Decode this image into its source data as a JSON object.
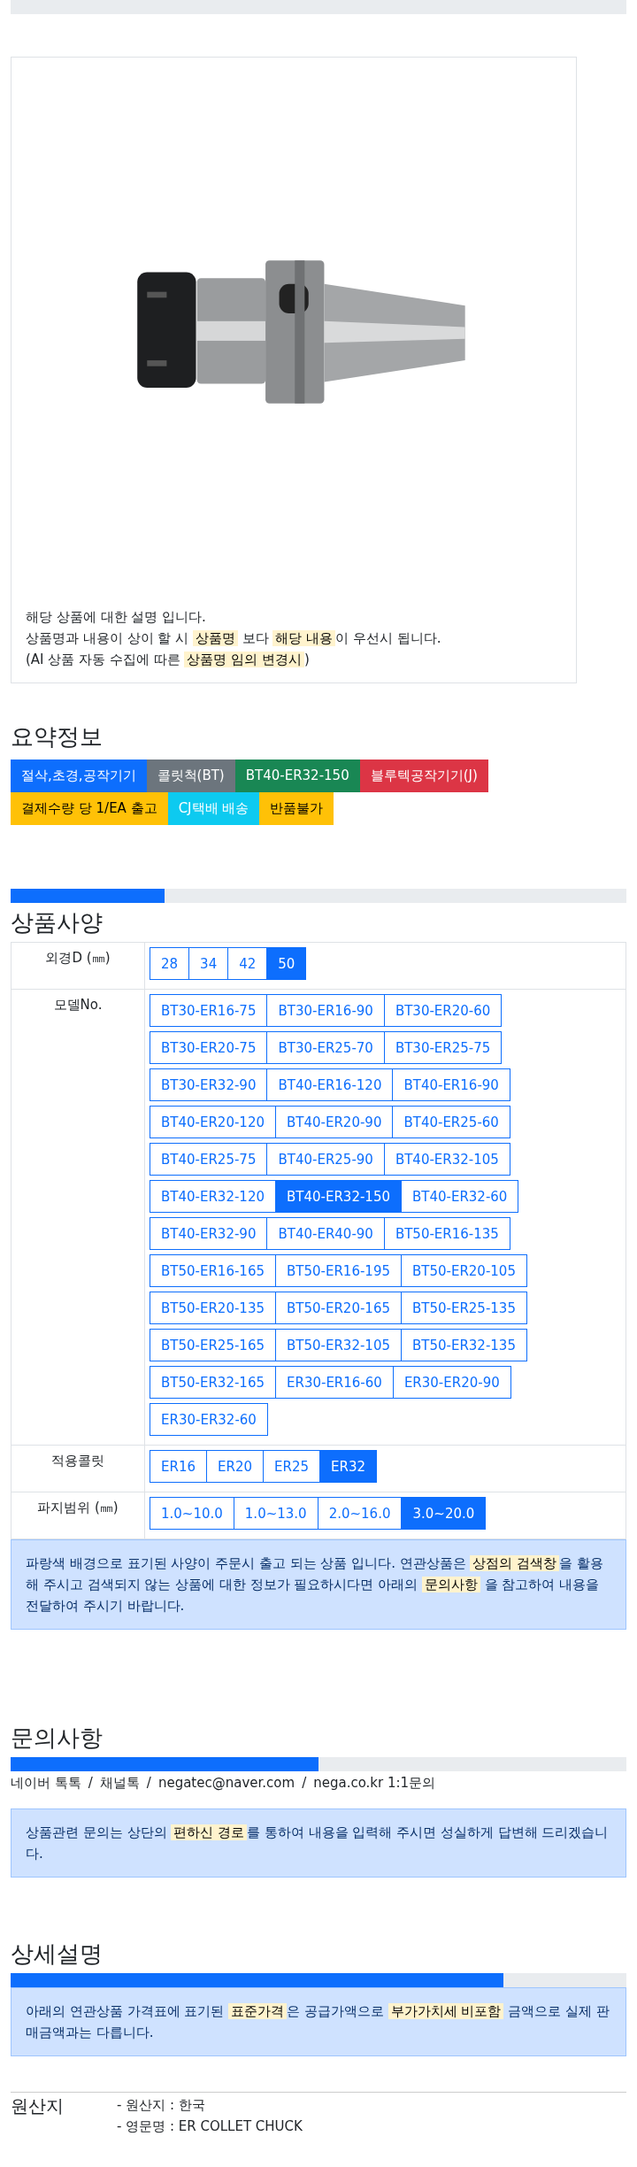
{
  "product_card": {
    "image": {
      "kind": "picture"
    },
    "notes": [
      [
        {
          "text": "해당 상품에 대한 설명 입니다.",
          "highlight": false
        }
      ],
      [
        {
          "text": "상품명과 내용이 상이 할 시 ",
          "highlight": false
        },
        {
          "text": "상품명",
          "highlight": true
        },
        {
          "text": " 보다 ",
          "highlight": false
        },
        {
          "text": "해당 내용",
          "highlight": true
        },
        {
          "text": "이 우선시 됩니다.",
          "highlight": false
        }
      ],
      [
        {
          "text": "(AI 상품 자동 수집에 따른 ",
          "highlight": false
        },
        {
          "text": "상품명 임의 변경시",
          "highlight": true
        },
        {
          "text": ")",
          "highlight": false
        }
      ]
    ]
  },
  "summary": {
    "title": "요약정보",
    "tags": [
      {
        "label": "절삭,초경,공작기기",
        "color": "#0d6efd"
      },
      {
        "label": "콜릿척(BT)",
        "color": "#6c757d"
      },
      {
        "label": "BT40-ER32-150",
        "color": "#198754"
      },
      {
        "label": "블루텍공작기기(J)",
        "color": "#dc3545"
      },
      {
        "label": "결제수량 당 1/EA 출고",
        "color": "#ffc107"
      },
      {
        "label": "CJ택배 배송",
        "color": "#0dcaf0"
      },
      {
        "label": "반품불가",
        "color": "#ffc107"
      }
    ]
  },
  "spec": {
    "progress": {
      "level": 0.25
    },
    "title": "상품사양",
    "rows": [
      {
        "label": "외경D (㎜)",
        "options": [
          {
            "label": "28",
            "selected": false
          },
          {
            "label": "34",
            "selected": false
          },
          {
            "label": "42",
            "selected": false
          },
          {
            "label": "50",
            "selected": true
          }
        ]
      },
      {
        "label": "모델No.",
        "options": [
          {
            "label": "BT30-ER16-75",
            "selected": false
          },
          {
            "label": "BT30-ER16-90",
            "selected": false
          },
          {
            "label": "BT30-ER20-60",
            "selected": false
          },
          {
            "label": "BT30-ER20-75",
            "selected": false
          },
          {
            "label": "BT30-ER25-70",
            "selected": false
          },
          {
            "label": "BT30-ER25-75",
            "selected": false
          },
          {
            "label": "BT30-ER32-90",
            "selected": false
          },
          {
            "label": "BT40-ER16-120",
            "selected": false
          },
          {
            "label": "BT40-ER16-90",
            "selected": false
          },
          {
            "label": "BT40-ER20-120",
            "selected": false
          },
          {
            "label": "BT40-ER20-90",
            "selected": false
          },
          {
            "label": "BT40-ER25-60",
            "selected": false
          },
          {
            "label": "BT40-ER25-75",
            "selected": false
          },
          {
            "label": "BT40-ER25-90",
            "selected": false
          },
          {
            "label": "BT40-ER32-105",
            "selected": false
          },
          {
            "label": "BT40-ER32-120",
            "selected": false
          },
          {
            "label": "BT40-ER32-150",
            "selected": true
          },
          {
            "label": "BT40-ER32-60",
            "selected": false
          },
          {
            "label": "BT40-ER32-90",
            "selected": false
          },
          {
            "label": "BT40-ER40-90",
            "selected": false
          },
          {
            "label": "BT50-ER16-135",
            "selected": false
          },
          {
            "label": "BT50-ER16-165",
            "selected": false
          },
          {
            "label": "BT50-ER16-195",
            "selected": false
          },
          {
            "label": "BT50-ER20-105",
            "selected": false
          },
          {
            "label": "BT50-ER20-135",
            "selected": false
          },
          {
            "label": "BT50-ER20-165",
            "selected": false
          },
          {
            "label": "BT50-ER25-135",
            "selected": false
          },
          {
            "label": "BT50-ER25-165",
            "selected": false
          },
          {
            "label": "BT50-ER32-105",
            "selected": false
          },
          {
            "label": "BT50-ER32-135",
            "selected": false
          },
          {
            "label": "BT50-ER32-165",
            "selected": false
          },
          {
            "label": "ER30-ER16-60",
            "selected": false
          },
          {
            "label": "ER30-ER20-90",
            "selected": false
          },
          {
            "label": "ER30-ER32-60",
            "selected": false
          }
        ]
      },
      {
        "label": "적용콜릿",
        "options": [
          {
            "label": "ER16",
            "selected": false
          },
          {
            "label": "ER20",
            "selected": false
          },
          {
            "label": "ER25",
            "selected": false
          },
          {
            "label": "ER32",
            "selected": true
          }
        ]
      },
      {
        "label": "파지범위 (㎜)",
        "options": [
          {
            "label": "1.0~10.0",
            "selected": false
          },
          {
            "label": "1.0~13.0",
            "selected": false
          },
          {
            "label": "2.0~16.0",
            "selected": false
          },
          {
            "label": "3.0~20.0",
            "selected": true
          }
        ]
      }
    ],
    "notice": [
      {
        "text": "파랑색 배경으로 표기된 사양이 주문시 출고 되는 상품 입니다. 연관상품은 ",
        "highlight": false
      },
      {
        "text": "상점의 검색창",
        "highlight": true
      },
      {
        "text": "을 활용해 주시고 검색되지 않는 상품에 대한 정보가 필요하시다면 아래의 ",
        "highlight": false
      },
      {
        "text": "문의사항",
        "highlight": true
      },
      {
        "text": " 을 참고하여 내용을 전달하여 주시기 바랍니다.",
        "highlight": false
      }
    ]
  },
  "inquiry": {
    "title": "문의사항",
    "progress": {
      "level": 0.5
    },
    "contacts": [
      "네이버 톡톡",
      "채널톡",
      "negatec@naver.com",
      "nega.co.kr 1:1문의"
    ],
    "separator": "/",
    "notice": [
      {
        "text": "상품관련 문의는 상단의 ",
        "highlight": false
      },
      {
        "text": "편하신 경로",
        "highlight": true
      },
      {
        "text": "를 통하여 내용을 입력해 주시면 성실하게 답변해 드리겠습니다.",
        "highlight": false
      }
    ]
  },
  "detail": {
    "title": "상세설명",
    "progress": {
      "level": 0.8
    },
    "notice": [
      {
        "text": "아래의 연관상품 가격표에 표기된 ",
        "highlight": false
      },
      {
        "text": "표준가격",
        "highlight": true
      },
      {
        "text": "은 공급가액으로 ",
        "highlight": false
      },
      {
        "text": "부가가치세 비포함",
        "highlight": true
      },
      {
        "text": " 금액으로 실제 판매금액과는 다릅니다.",
        "highlight": false
      }
    ]
  },
  "origin": {
    "label": "원산지",
    "lines": [
      "- 원산지 : 한국",
      "- 영문명 : ER COLLET CHUCK"
    ]
  }
}
